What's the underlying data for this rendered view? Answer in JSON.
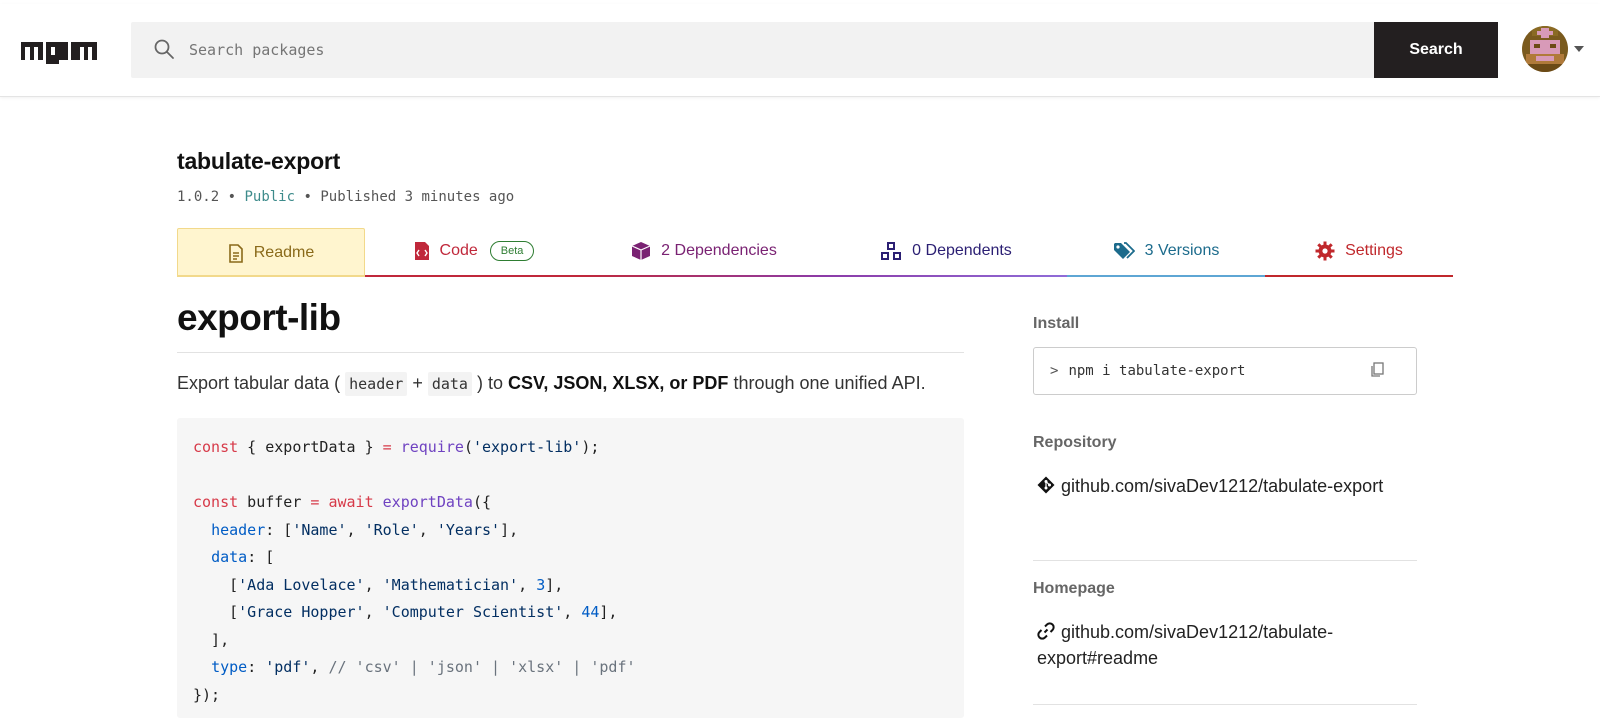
{
  "header": {
    "logo_text": "npm",
    "search": {
      "placeholder": "Search packages",
      "value": ""
    },
    "search_button": "Search"
  },
  "package": {
    "name": "tabulate-export",
    "version": "1.0.2",
    "separator": "•",
    "visibility": "Public",
    "published": "Published 3 minutes ago"
  },
  "tabs": [
    {
      "label": "Readme",
      "icon": "document-icon",
      "active": true,
      "color": "#8a6a1a",
      "line": "#f2d98b"
    },
    {
      "label": "Code",
      "icon": "code-file-icon",
      "badge": "Beta",
      "color": "#c0283b",
      "line": "#c0283b"
    },
    {
      "label": "2 Dependencies",
      "icon": "box-icon",
      "color": "#7a2273",
      "line": "#8c3ba8"
    },
    {
      "label": "0 Dependents",
      "icon": "boxes-icon",
      "color": "#2b1f73",
      "line": "#8f6cd8"
    },
    {
      "label": "3 Versions",
      "icon": "tags-icon",
      "color": "#1c6b8c",
      "line": "#5ea6d4"
    },
    {
      "label": "Settings",
      "icon": "gear-icon",
      "color": "#c0282c",
      "line": "#c0282c"
    }
  ],
  "readme": {
    "heading": "export-lib",
    "intro_prefix": "Export tabular data (",
    "code_header": "header",
    "plus": "+",
    "code_data": "data",
    "intro_mid": ") to",
    "formats": "CSV, JSON, XLSX, or PDF",
    "intro_suffix": "through one unified API."
  },
  "sidebar": {
    "install_label": "Install",
    "install_command": "npm i tabulate-export",
    "repository_label": "Repository",
    "repository_link": "github.com/sivaDev1212/tabulate-export",
    "homepage_label": "Homepage",
    "homepage_link": "github.com/sivaDev1212/tabulate-export#readme"
  },
  "colors": {
    "search_button_bg": "#231f20",
    "public": "#3d8b8b"
  }
}
